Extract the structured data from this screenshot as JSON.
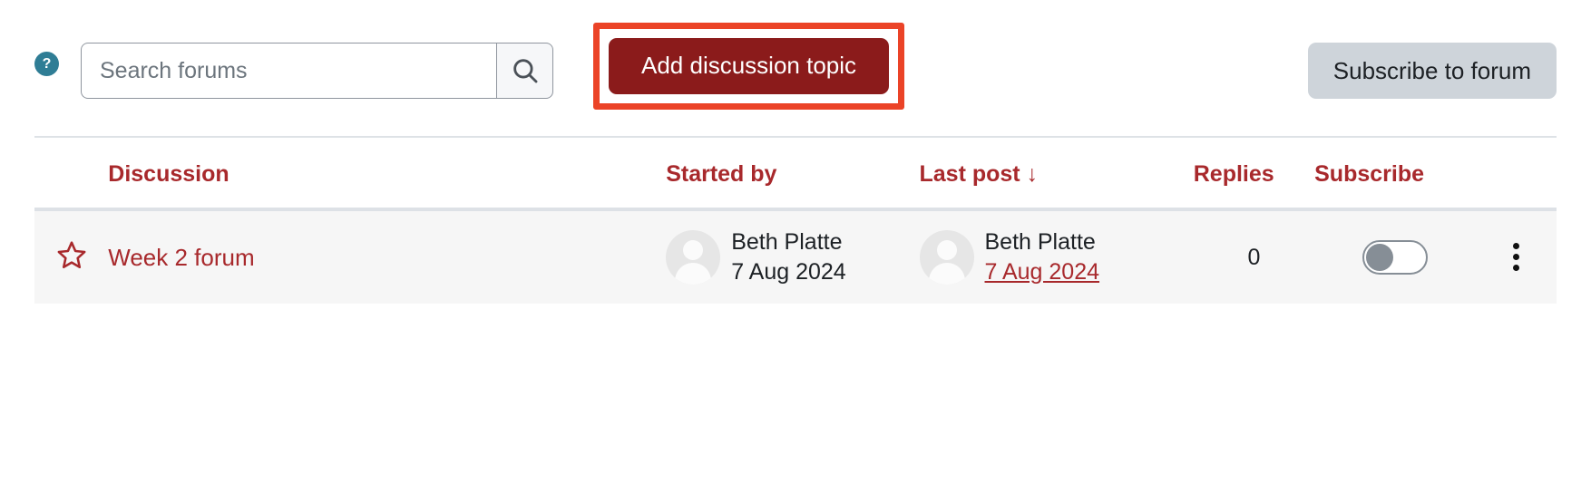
{
  "toolbar": {
    "help_icon": "question-mark-icon",
    "help_label": "?",
    "search": {
      "placeholder": "Search forums",
      "value": "",
      "submit_icon": "search-icon"
    },
    "primary_button": {
      "label": "Add discussion topic",
      "background": "#8b1b1b",
      "text_color": "#ffffff",
      "highlight_border_color": "#eb4327"
    },
    "secondary_button": {
      "label": "Subscribe to forum",
      "background": "#ced4da",
      "text_color": "#1d2125"
    }
  },
  "table": {
    "headers": {
      "star": "",
      "discussion": "Discussion",
      "started_by": "Started by",
      "last_post": "Last post",
      "last_post_sort_icon": "arrow-down-icon",
      "last_post_sort_glyph": "↓",
      "replies": "Replies",
      "subscribe": "Subscribe",
      "menu": ""
    },
    "header_link_color": "#a8292c",
    "rows": [
      {
        "star_icon": "star-outline-icon",
        "starred": false,
        "topic": "Week 2 forum",
        "started_by": {
          "avatar": "default-user-avatar",
          "name": "Beth Platte",
          "date": "7 Aug 2024"
        },
        "last_post": {
          "avatar": "default-user-avatar",
          "name": "Beth Platte",
          "date": "7 Aug 2024"
        },
        "replies": "0",
        "subscribed": false,
        "menu_icon": "kebab-menu-icon"
      }
    ]
  }
}
